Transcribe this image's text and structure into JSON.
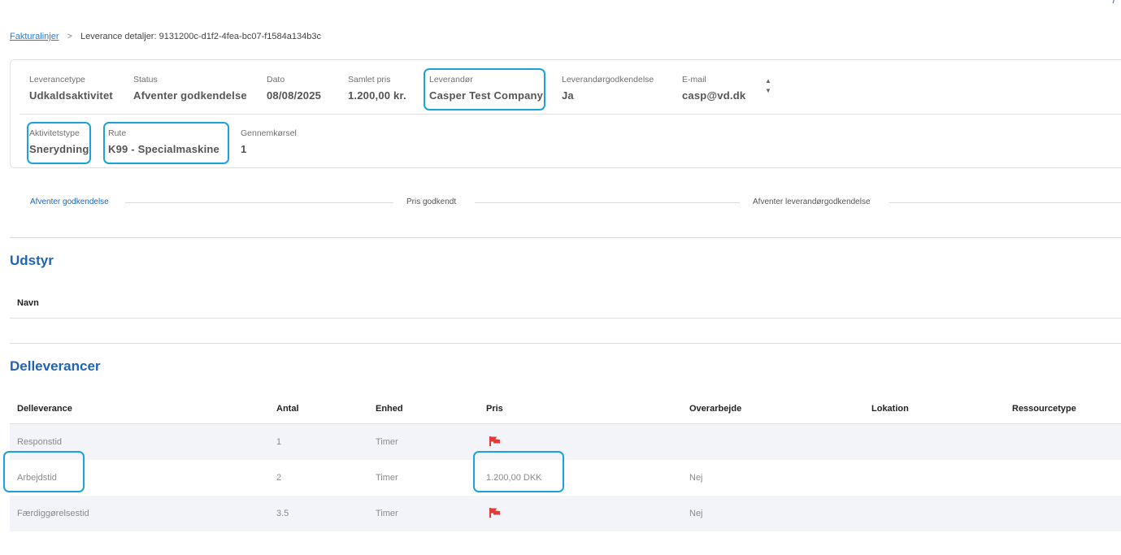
{
  "breadcrumb": {
    "link": "Fakturalinjer",
    "separator": ">",
    "current": "Leverance detaljer: 9131200c-d1f2-4fea-bc07-f1584a134b3c"
  },
  "details": {
    "leverancetype": {
      "label": "Leverancetype",
      "value": "Udkaldsaktivitet"
    },
    "status": {
      "label": "Status",
      "value": "Afventer godkendelse"
    },
    "dato": {
      "label": "Dato",
      "value": "08/08/2025"
    },
    "samlet_pris": {
      "label": "Samlet pris",
      "value": "1.200,00 kr."
    },
    "leverandor": {
      "label": "Leverandør",
      "value": "Casper Test Company"
    },
    "leverandorgodkendelse": {
      "label": "Leverandørgodkendelse",
      "value": "Ja"
    },
    "email": {
      "label": "E-mail",
      "value": "casp@vd.dk"
    },
    "aktivitetstype": {
      "label": "Aktivitetstype",
      "value": "Snerydning"
    },
    "rute": {
      "label": "Rute",
      "value": "K99 - Specialmaskine"
    },
    "gennemkorsel": {
      "label": "Gennemkørsel",
      "value": "1"
    }
  },
  "sort": {
    "up": "▲",
    "down": "▼"
  },
  "steps": [
    {
      "label": "Afventer godkendelse",
      "active": true
    },
    {
      "label": "Pris godkendt",
      "active": false
    },
    {
      "label": "Afventer leverandørgodkendelse",
      "active": false
    }
  ],
  "udstyr": {
    "title": "Udstyr",
    "columns": [
      "Navn"
    ]
  },
  "delleverancer": {
    "title": "Delleverancer",
    "columns": [
      "Delleverance",
      "Antal",
      "Enhed",
      "Pris",
      "Overarbejde",
      "Lokation",
      "Ressourcetype"
    ],
    "rows": [
      {
        "delleverance": "Responstid",
        "antal": "1",
        "enhed": "Timer",
        "pris": "",
        "pris_icon": "red-flag-icon",
        "overarbejde": "",
        "lokation": "",
        "ressourcetype": ""
      },
      {
        "delleverance": "Arbejdstid",
        "antal": "2",
        "enhed": "Timer",
        "pris": "1.200,00 DKK",
        "pris_icon": "",
        "overarbejde": "Nej",
        "lokation": "",
        "ressourcetype": ""
      },
      {
        "delleverance": "Færdiggørelsestid",
        "antal": "3.5",
        "enhed": "Timer",
        "pris": "",
        "pris_icon": "red-flag-icon",
        "overarbejde": "Nej",
        "lokation": "",
        "ressourcetype": ""
      }
    ]
  },
  "colors": {
    "accent": "#1f64b5",
    "highlight": "#1aa3d9",
    "flag": "#e53935",
    "row_alt": "#f3f4f9"
  }
}
